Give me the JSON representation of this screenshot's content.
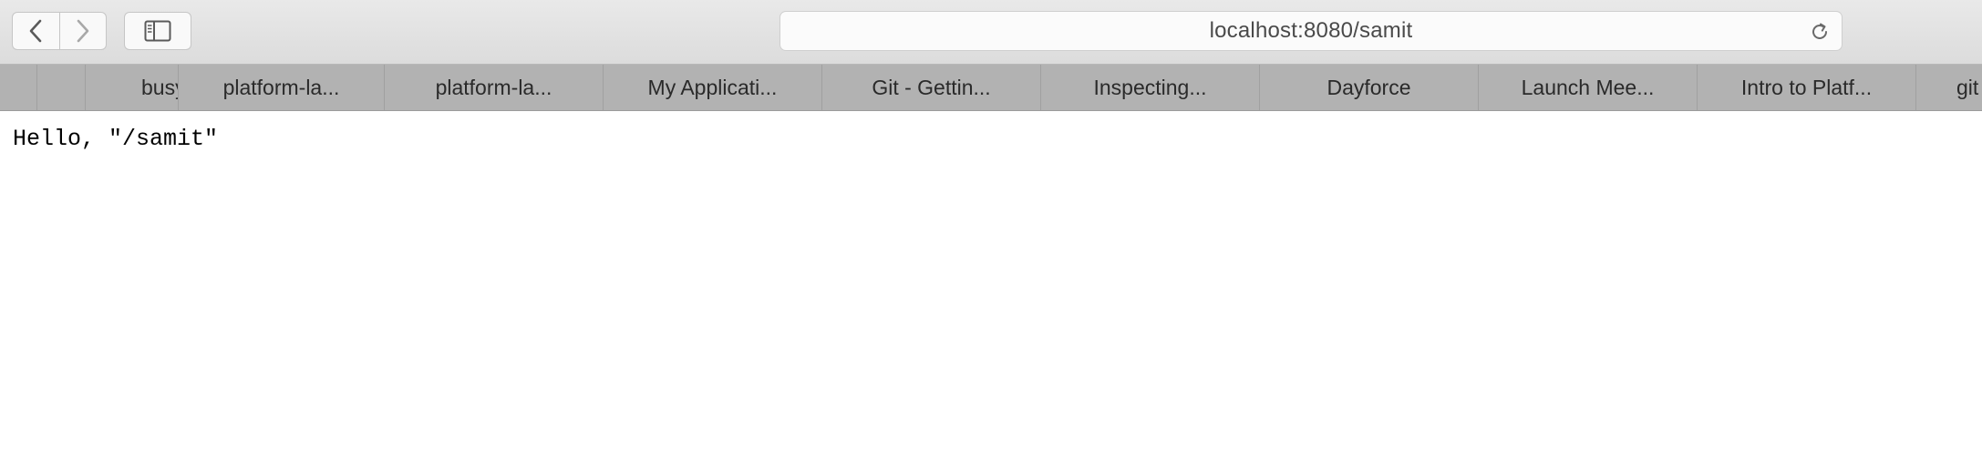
{
  "toolbar": {
    "back_icon": "chevron-left-icon",
    "forward_icon": "chevron-right-icon",
    "sidebar_icon": "sidebar-icon",
    "reload_icon": "reload-icon",
    "url": "localhost:8080/samit"
  },
  "bookmarks": [
    "",
    "",
    "busy",
    "platform-la...",
    "platform-la...",
    "My Applicati...",
    "Git - Gettin...",
    "Inspecting...",
    "Dayforce",
    "Launch Mee...",
    "Intro to Platf...",
    "git"
  ],
  "page": {
    "text": "Hello, \"/samit\""
  }
}
